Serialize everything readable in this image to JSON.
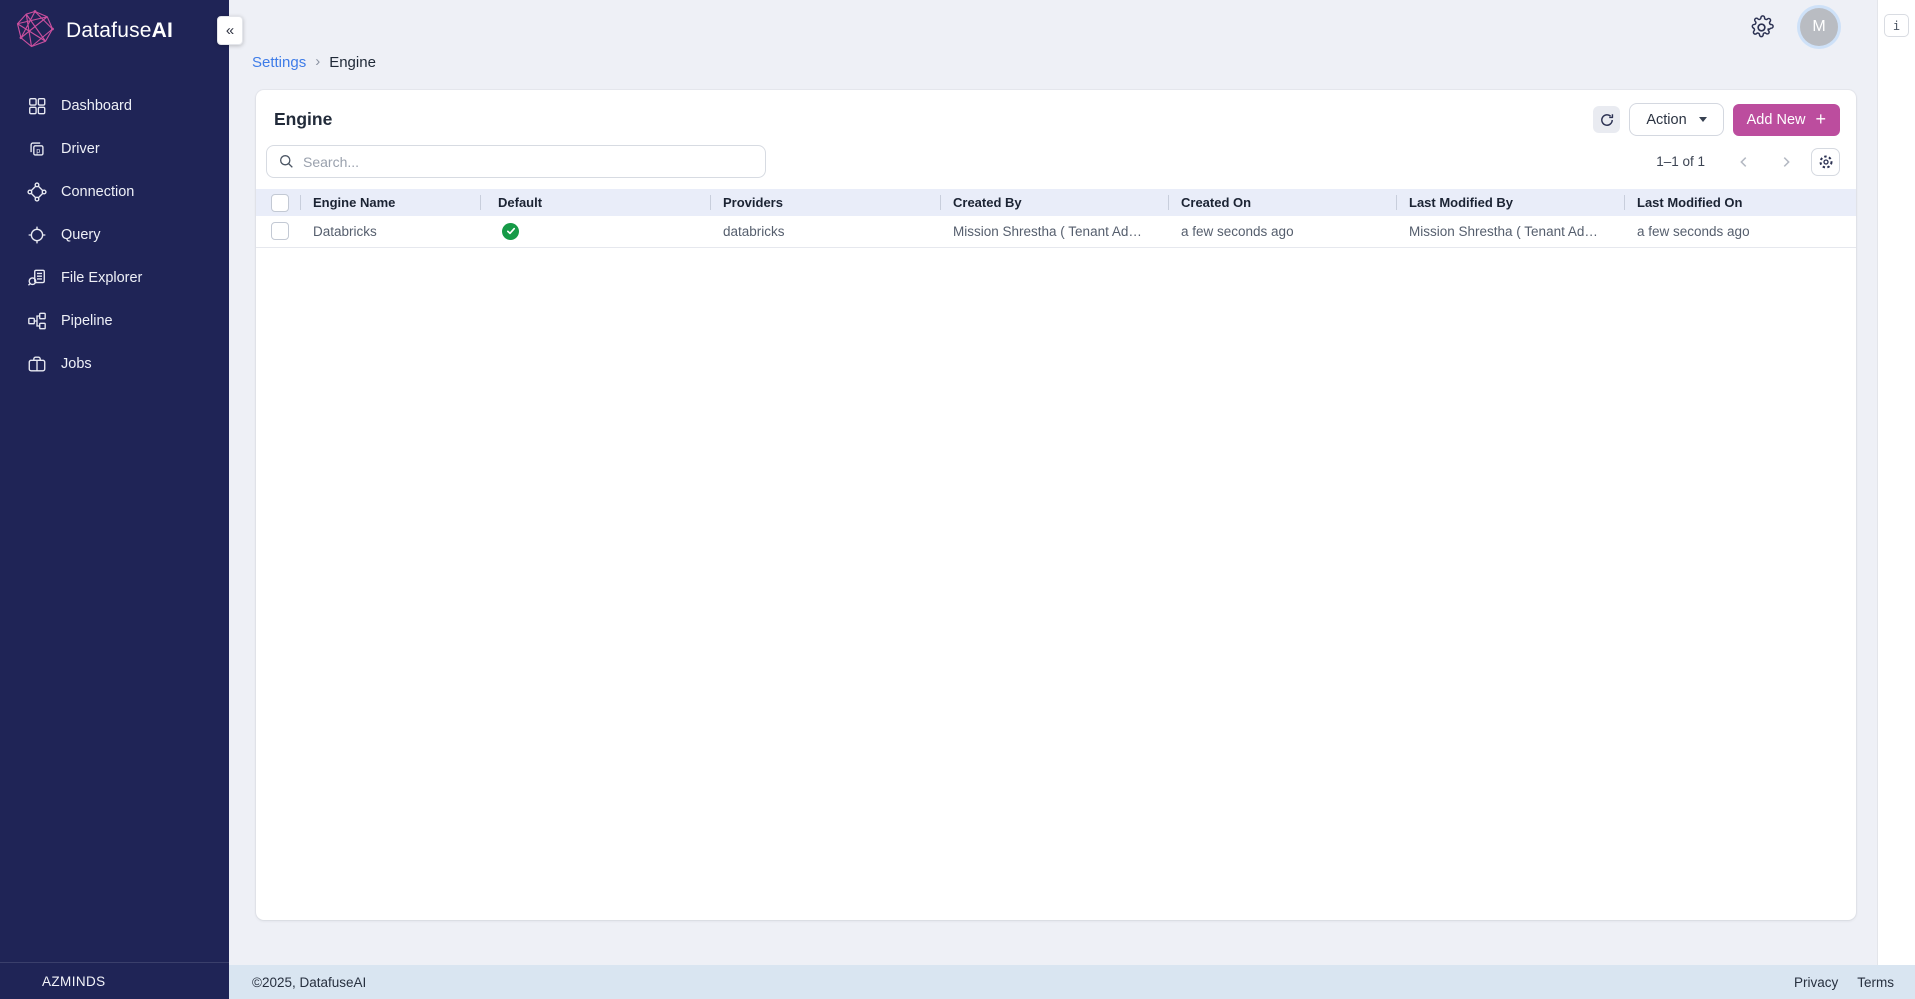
{
  "app": {
    "brand_regular": "Datafuse",
    "brand_bold": "AI",
    "sidebar_footer_text": "AZMINDS",
    "collapse_glyph": "«"
  },
  "sidebar": {
    "items": [
      {
        "label": "Dashboard",
        "icon": "dashboard-icon"
      },
      {
        "label": "Driver",
        "icon": "driver-icon"
      },
      {
        "label": "Connection",
        "icon": "connection-icon"
      },
      {
        "label": "Query",
        "icon": "query-icon"
      },
      {
        "label": "File Explorer",
        "icon": "file-explorer-icon"
      },
      {
        "label": "Pipeline",
        "icon": "pipeline-icon"
      },
      {
        "label": "Jobs",
        "icon": "jobs-icon"
      }
    ]
  },
  "topbar": {
    "avatar_initial": "M"
  },
  "breadcrumb": {
    "items": [
      "Settings",
      "Engine"
    ],
    "separator": "›"
  },
  "page": {
    "title": "Engine",
    "action_label": "Action",
    "add_new_label": "Add New",
    "add_new_plus": "+",
    "search_placeholder": "Search...",
    "pagination_range": "1–1 of 1"
  },
  "table": {
    "columns": [
      "Engine Name",
      "Default",
      "Providers",
      "Created By",
      "Created On",
      "Last Modified By",
      "Last Modified On"
    ],
    "rows": [
      {
        "engine_name": "Databricks",
        "default": true,
        "providers": "databricks",
        "created_by": "Mission Shrestha ( Tenant Ad…",
        "created_on": "a few seconds ago",
        "last_modified_by": "Mission Shrestha ( Tenant Ad…",
        "last_modified_on": "a few seconds ago"
      }
    ]
  },
  "footer": {
    "copyright": "©2025, DatafuseAI",
    "links": [
      "Privacy",
      "Terms"
    ]
  },
  "right_panel": {
    "info_label": "i"
  },
  "colors": {
    "sidebar_navy": "#1f2456",
    "accent_magenta": "#bc4d9e",
    "logo_pink": "#c94f9e",
    "link_blue": "#3e7ce8",
    "table_header_bg": "#e9edf9",
    "footer_bar_bg": "#d9e5f1",
    "default_check_green": "#169a47",
    "main_bg": "#eef0f6"
  }
}
